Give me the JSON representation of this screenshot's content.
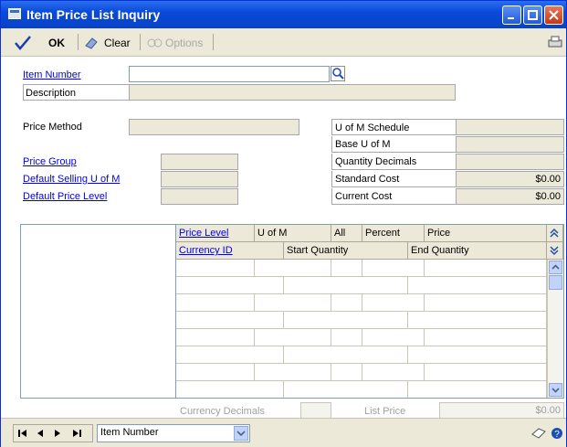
{
  "window": {
    "title": "Item Price List Inquiry"
  },
  "toolbar": {
    "ok_label": "OK",
    "clear_label": "Clear",
    "options_label": "Options"
  },
  "fields": {
    "item_number_label": "Item Number",
    "item_number_value": "",
    "description_label": "Description",
    "price_method_label": "Price Method",
    "price_group_label": "Price Group",
    "default_selling_uofm_label": "Default Selling U of M",
    "default_price_level_label": "Default Price Level",
    "uofm_schedule_label": "U of M Schedule",
    "base_uofm_label": "Base U of M",
    "quantity_decimals_label": "Quantity Decimals",
    "standard_cost_label": "Standard Cost",
    "standard_cost_value": "$0.00",
    "current_cost_label": "Current Cost",
    "current_cost_value": "$0.00"
  },
  "grid": {
    "header_row1": [
      "Price Level",
      "U of M",
      "All",
      "Percent",
      "Price"
    ],
    "header_row2": [
      "Currency ID",
      "Start Quantity",
      "End Quantity"
    ]
  },
  "footer": {
    "currency_decimals_label": "Currency Decimals",
    "list_price_label": "List Price",
    "list_price_value": "$0.00"
  },
  "statusbar": {
    "sort_selected": "Item Number"
  }
}
